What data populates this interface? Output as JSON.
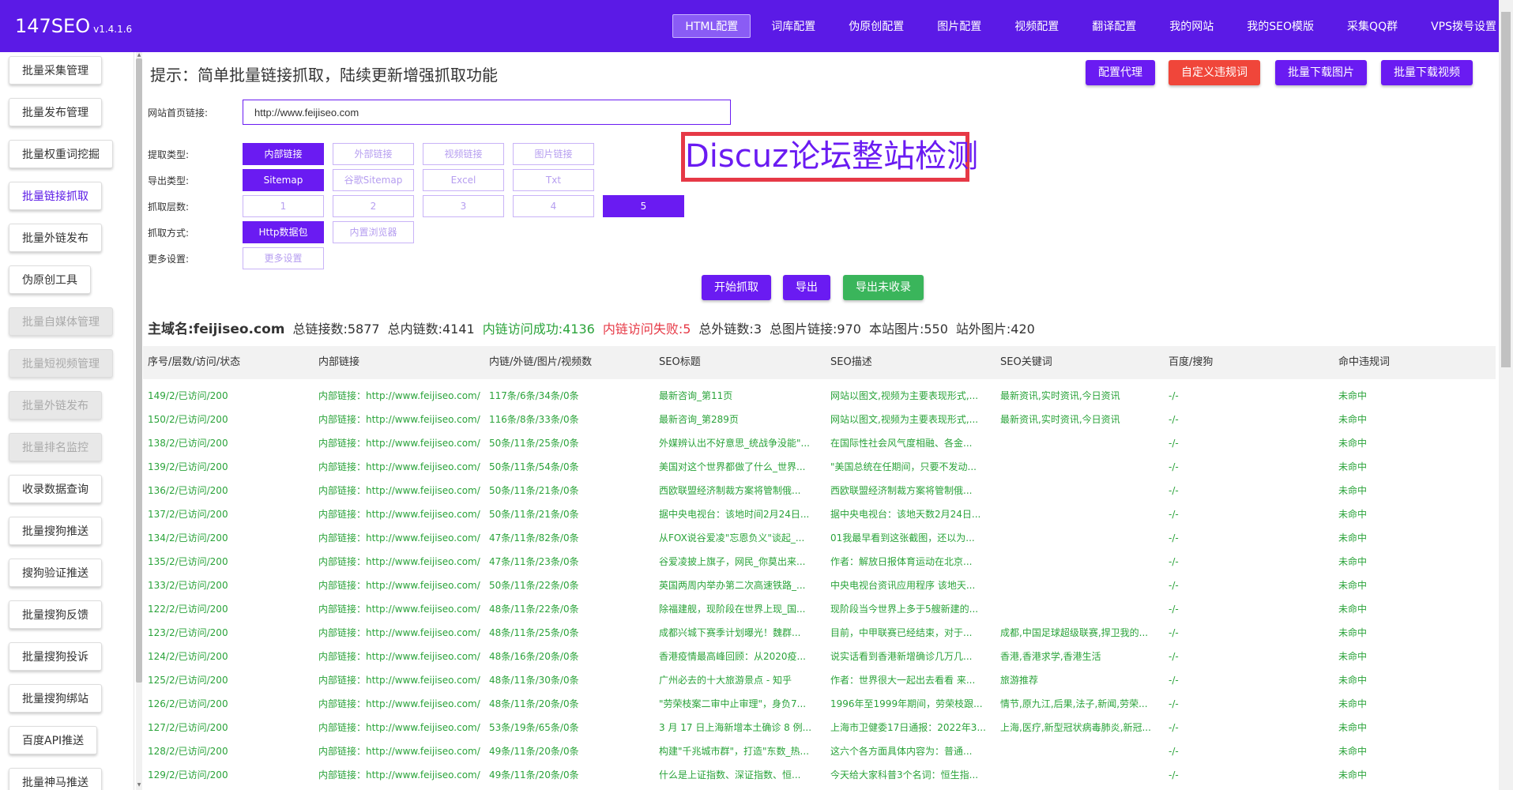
{
  "app": {
    "name": "147SEO",
    "version": "v1.4.1.6"
  },
  "nav": [
    {
      "label": "HTML配置",
      "active": true
    },
    {
      "label": "词库配置"
    },
    {
      "label": "伪原创配置"
    },
    {
      "label": "图片配置"
    },
    {
      "label": "视频配置"
    },
    {
      "label": "翻译配置"
    },
    {
      "label": "我的网站"
    },
    {
      "label": "我的SEO模版"
    },
    {
      "label": "采集QQ群"
    },
    {
      "label": "VPS拨号设置"
    }
  ],
  "sidebar": [
    {
      "label": "批量采集管理",
      "state": "normal"
    },
    {
      "label": "批量发布管理",
      "state": "normal"
    },
    {
      "label": "批量权重词挖掘",
      "state": "normal"
    },
    {
      "label": "批量链接抓取",
      "state": "active"
    },
    {
      "label": "批量外链发布",
      "state": "normal"
    },
    {
      "label": "伪原创工具",
      "state": "normal"
    },
    {
      "label": "批量自媒体管理",
      "state": "disabled"
    },
    {
      "label": "批量短视频管理",
      "state": "disabled"
    },
    {
      "label": "批量外链发布",
      "state": "disabled"
    },
    {
      "label": "批量排名监控",
      "state": "disabled"
    },
    {
      "label": "收录数据查询",
      "state": "normal"
    },
    {
      "label": "批量搜狗推送",
      "state": "normal"
    },
    {
      "label": "搜狗验证推送",
      "state": "normal"
    },
    {
      "label": "批量搜狗反馈",
      "state": "normal"
    },
    {
      "label": "批量搜狗投诉",
      "state": "normal"
    },
    {
      "label": "批量搜狗绑站",
      "state": "normal"
    },
    {
      "label": "百度API推送",
      "state": "normal"
    },
    {
      "label": "批量神马推送",
      "state": "normal"
    }
  ],
  "tip": "提示：简单批量链接抓取，陆续更新增强抓取功能",
  "top_buttons": {
    "proxy": "配置代理",
    "custom_words": "自定义违规词",
    "download_images": "批量下载图片",
    "download_videos": "批量下载视频"
  },
  "form": {
    "url_label": "网站首页链接:",
    "url_value": "http://www.feijiseo.com",
    "extract_label": "提取类型:",
    "extract_options": [
      {
        "label": "内部链接",
        "selected": true
      },
      {
        "label": "外部链接"
      },
      {
        "label": "视频链接"
      },
      {
        "label": "图片链接"
      }
    ],
    "export_label": "导出类型:",
    "export_options": [
      {
        "label": "Sitemap",
        "selected": true
      },
      {
        "label": "谷歌Sitemap"
      },
      {
        "label": "Excel"
      },
      {
        "label": "Txt"
      }
    ],
    "depth_label": "抓取层数:",
    "depth_options": [
      {
        "label": "1"
      },
      {
        "label": "2"
      },
      {
        "label": "3"
      },
      {
        "label": "4"
      },
      {
        "label": "5",
        "selected": true
      }
    ],
    "method_label": "抓取方式:",
    "method_options": [
      {
        "label": "Http数据包",
        "selected": true
      },
      {
        "label": "内置浏览器"
      }
    ],
    "more_label": "更多设置:",
    "more_button": "更多设置"
  },
  "banner": "Discuz论坛整站检测",
  "actions": {
    "start": "开始抓取",
    "export": "导出",
    "export_unindexed": "导出未收录"
  },
  "stats": {
    "domain": "主域名:feijiseo.com",
    "total_links": "总链接数:5877",
    "total_internal": "总内链数:4141",
    "internal_ok": "内链访问成功:4136",
    "internal_fail": "内链访问失败:5",
    "total_external": "总外链数:3",
    "total_images": "总图片链接:970",
    "local_images": "本站图片:550",
    "external_images": "站外图片:420"
  },
  "table": {
    "headers": [
      "序号/层数/访问/状态",
      "内部链接",
      "内链/外链/图片/视频数",
      "SEO标题",
      "SEO描述",
      "SEO关键词",
      "百度/搜狗",
      "命中违规词"
    ],
    "rows": [
      [
        "149/2/已访问/200",
        "内部链接：http://www.feijiseo.com/index",
        "117条/6条/34条/0条",
        "最新咨询_第11页",
        "网站以图文,视频为主要表现形式,...",
        "最新资讯,实时资讯,今日资讯",
        "-/-",
        "未命中"
      ],
      [
        "150/2/已访问/200",
        "内部链接：http://www.feijiseo.com/index",
        "116条/8条/33条/0条",
        "最新咨询_第289页",
        "网站以图文,视频为主要表现形式,...",
        "最新资讯,实时资讯,今日资讯",
        "-/-",
        "未命中"
      ],
      [
        "138/2/已访问/200",
        "内部链接：http://www.feijiseo.com/index",
        "50条/11条/25条/0条",
        "外媒辨认出不好意思_统战争没能\"...",
        "在国际性社会风气度相融、各金...",
        "",
        "-/-",
        "未命中"
      ],
      [
        "139/2/已访问/200",
        "内部链接：http://www.feijiseo.com/index",
        "50条/11条/54条/0条",
        "美国对这个世界都做了什么_世界...",
        "\"美国总统在任期间，只要不发动...",
        "",
        "-/-",
        "未命中"
      ],
      [
        "136/2/已访问/200",
        "内部链接：http://www.feijiseo.com/index",
        "50条/11条/21条/0条",
        "西欧联盟经济制裁方案将管制俄...",
        "西欧联盟经济制裁方案将管制俄...",
        "",
        "-/-",
        "未命中"
      ],
      [
        "137/2/已访问/200",
        "内部链接：http://www.feijiseo.com/index",
        "50条/11条/21条/0条",
        "据中央电视台：该地时间2月24日...",
        "据中央电视台：该地天数2月24日...",
        "",
        "-/-",
        "未命中"
      ],
      [
        "134/2/已访问/200",
        "内部链接：http://www.feijiseo.com/index",
        "47条/11条/82条/0条",
        "从FOX说谷爱凌\"忘恩负义\"谈起_...",
        "01我最早看到这张截图，还以为...",
        "",
        "-/-",
        "未命中"
      ],
      [
        "135/2/已访问/200",
        "内部链接：http://www.feijiseo.com/index",
        "47条/11条/23条/0条",
        "谷爱凌披上旗子，网民_你莫出来...",
        "作者：解放日报体育运动在北京...",
        "",
        "-/-",
        "未命中"
      ],
      [
        "133/2/已访问/200",
        "内部链接：http://www.feijiseo.com/index",
        "50条/11条/22条/0条",
        "英国两周内举办第二次高速铁路_...",
        "中央电视台资讯应用程序 该地天...",
        "",
        "-/-",
        "未命中"
      ],
      [
        "122/2/已访问/200",
        "内部链接：http://www.feijiseo.com/index",
        "48条/11条/22条/0条",
        "除福建舰，现阶段在世界上现_国...",
        "现阶段当今世界上多于5艘新建的...",
        "",
        "-/-",
        "未命中"
      ],
      [
        "123/2/已访问/200",
        "内部链接：http://www.feijiseo.com/index",
        "48条/11条/25条/0条",
        "成都兴城下赛季计划曝光！魏群...",
        "目前，中甲联赛已经结束，对于...",
        "成都,中国足球超级联赛,捍卫我的...",
        "-/-",
        "未命中"
      ],
      [
        "124/2/已访问/200",
        "内部链接：http://www.feijiseo.com/index",
        "48条/16条/20条/0条",
        "香港疫情最高峰回顾：从2020疫...",
        "说实话看到香港新增确诊几万几...",
        "香港,香港求学,香港生活",
        "-/-",
        "未命中"
      ],
      [
        "125/2/已访问/200",
        "内部链接：http://www.feijiseo.com/index",
        "48条/11条/30条/0条",
        "广州必去的十大旅游景点 - 知乎",
        "作者：世界很大一起出去看看 来...",
        "旅游推荐",
        "-/-",
        "未命中"
      ],
      [
        "126/2/已访问/200",
        "内部链接：http://www.feijiseo.com/index",
        "48条/11条/20条/0条",
        "\"劳荣枝案二审中止审理\"，身负7...",
        "1996年至1999年期间，劳荣枝跟...",
        "情节,原九江,后果,法子,新闻,劳荣...",
        "-/-",
        "未命中"
      ],
      [
        "127/2/已访问/200",
        "内部链接：http://www.feijiseo.com/index",
        "53条/19条/65条/0条",
        "3 月 17 日上海新增本土确诊 8 例...",
        "上海市卫健委17日通报：2022年3...",
        "上海,医疗,新型冠状病毒肺炎,新冠...",
        "-/-",
        "未命中"
      ],
      [
        "128/2/已访问/200",
        "内部链接：http://www.feijiseo.com/index",
        "49条/11条/20条/0条",
        "构建\"千兆城市群\"，打造\"东数_热...",
        "这六个各方面具体内容为：普通...",
        "",
        "-/-",
        "未命中"
      ],
      [
        "129/2/已访问/200",
        "内部链接：http://www.feijiseo.com/index",
        "49条/11条/20条/0条",
        "什么是上证指数、深证指数、恒...",
        "今天给大家科普3个名词：恒生指...",
        "",
        "-/-",
        "未命中"
      ]
    ]
  }
}
